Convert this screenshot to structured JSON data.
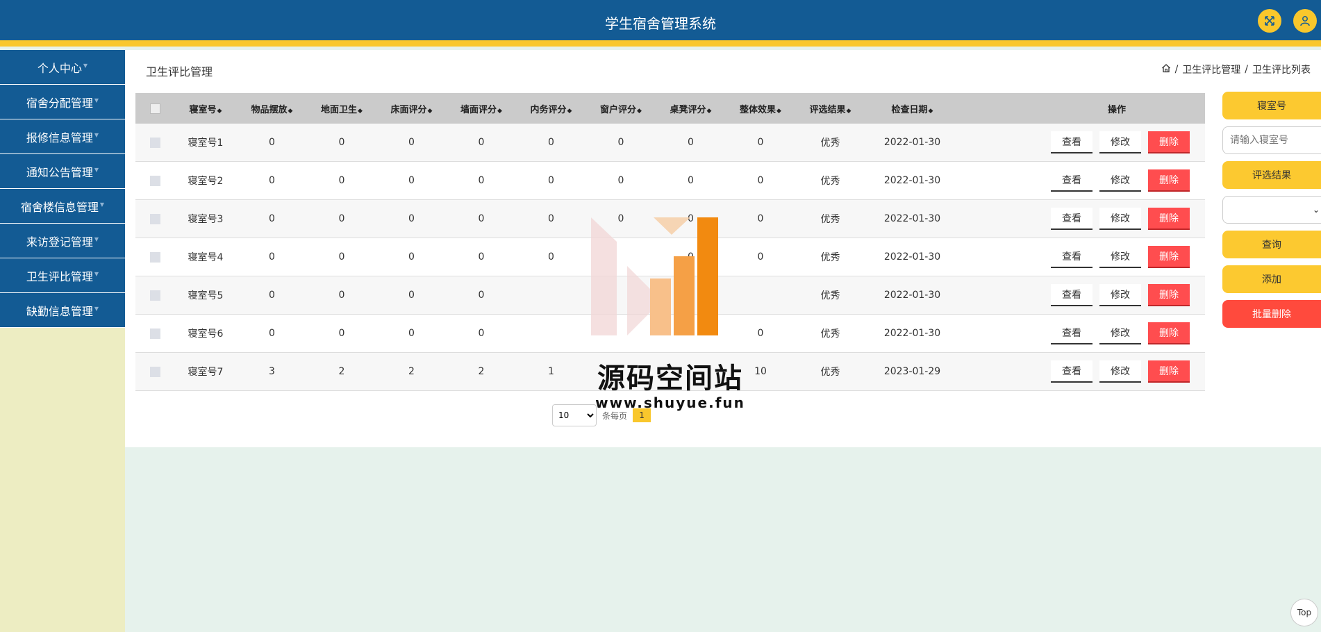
{
  "header": {
    "title": "学生宿舍管理系统"
  },
  "sidebar": {
    "items": [
      {
        "label": "个人中心"
      },
      {
        "label": "宿舍分配管理"
      },
      {
        "label": "报修信息管理"
      },
      {
        "label": "通知公告管理"
      },
      {
        "label": "宿舍楼信息管理"
      },
      {
        "label": "来访登记管理"
      },
      {
        "label": "卫生评比管理"
      },
      {
        "label": "缺勤信息管理"
      }
    ]
  },
  "page": {
    "title": "卫生评比管理",
    "breadcrumb": [
      "卫生评比管理",
      "卫生评比列表"
    ]
  },
  "table": {
    "columns": [
      "寝室号",
      "物品摆放",
      "地面卫生",
      "床面评分",
      "墙面评分",
      "内务评分",
      "窗户评分",
      "桌凳评分",
      "整体效果",
      "评选结果",
      "检查日期",
      "操作"
    ],
    "rows": [
      [
        "寝室号1",
        "0",
        "0",
        "0",
        "0",
        "0",
        "0",
        "0",
        "0",
        "优秀",
        "2022-01-30"
      ],
      [
        "寝室号2",
        "0",
        "0",
        "0",
        "0",
        "0",
        "0",
        "0",
        "0",
        "优秀",
        "2022-01-30"
      ],
      [
        "寝室号3",
        "0",
        "0",
        "0",
        "0",
        "0",
        "0",
        "0",
        "0",
        "优秀",
        "2022-01-30"
      ],
      [
        "寝室号4",
        "0",
        "0",
        "0",
        "0",
        "0",
        "",
        "0",
        "0",
        "优秀",
        "2022-01-30"
      ],
      [
        "寝室号5",
        "0",
        "0",
        "0",
        "0",
        "",
        "",
        "",
        "",
        "优秀",
        "2022-01-30"
      ],
      [
        "寝室号6",
        "0",
        "0",
        "0",
        "0",
        "",
        "",
        "",
        "0",
        "优秀",
        "2022-01-30"
      ],
      [
        "寝室号7",
        "3",
        "2",
        "2",
        "2",
        "1",
        "",
        "",
        "10",
        "优秀",
        "2023-01-29"
      ]
    ],
    "actions": {
      "view": "查看",
      "edit": "修改",
      "delete": "删除"
    }
  },
  "pagination": {
    "page_size": "10",
    "per_page_label": "条每页",
    "current_page": "1"
  },
  "search_panel": {
    "room_label": "寝室号",
    "room_placeholder": "请输入寝室号",
    "result_label": "评选结果",
    "query": "查询",
    "add": "添加",
    "batch_delete": "批量删除"
  },
  "watermark": {
    "title": "源码空间站",
    "url": "www.shuyue.fun"
  },
  "back_to_top": "Top"
}
